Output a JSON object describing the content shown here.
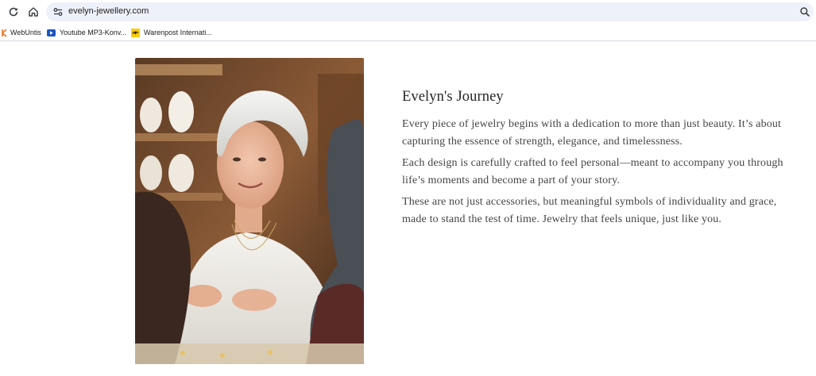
{
  "browser": {
    "url": "evelyn-jewellery.com",
    "bookmarks": [
      {
        "label": "WebUntis",
        "icon": "webuntis-icon"
      },
      {
        "label": "Youtube MP3-Konv...",
        "icon": "youtube-icon"
      },
      {
        "label": "Warenpost Internati...",
        "icon": "post-horn-icon"
      }
    ]
  },
  "story": {
    "title": "Evelyn's Journey",
    "paragraphs": [
      "Every piece of jewelry begins with a dedication to more than just beauty. It’s about capturing the essence of strength, elegance, and timelessness.",
      "Each design is carefully crafted to feel personal—meant to accompany you through life’s moments and become a part of your story.",
      "These are not just accessories, but meaningful symbols of individuality and grace, made to stand the test of time. Jewelry that feels unique, just like you."
    ]
  },
  "colors": {
    "omnibox": "#eef1f9",
    "text": "#454545",
    "title": "#262626"
  }
}
